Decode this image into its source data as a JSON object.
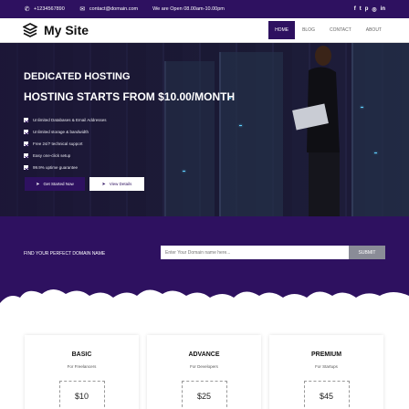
{
  "topbar": {
    "phone": "+1234567890",
    "email": "contact@domain.com",
    "hours": "We are Open 08.00am-10.00pm",
    "social_icons": [
      "facebook-icon",
      "twitter-icon",
      "pinterest-icon",
      "instagram-icon",
      "linkedin-icon"
    ],
    "social_glyphs": [
      "f",
      "t",
      "p",
      "◎",
      "in"
    ]
  },
  "nav": {
    "brand": "My Site",
    "items": [
      {
        "label": "HOME",
        "active": true
      },
      {
        "label": "BLOG",
        "active": false
      },
      {
        "label": "CONTACT",
        "active": false
      },
      {
        "label": "ABOUT",
        "active": false
      }
    ]
  },
  "hero": {
    "title": "DEDICATED HOSTING",
    "subtitle": "HOSTING STARTS FROM $10.00/MONTH",
    "features": [
      "Unlimited Databases & Email Addresses",
      "Unlimited storage & bandwidth",
      "Free 24/7 technical support",
      "Easy one-click setup",
      "99.9% uptime guarantee"
    ],
    "primary_button": "Get Started Now",
    "secondary_button": "View Details"
  },
  "domain": {
    "label": "FIND YOUR PERFECT DOMAIN NAME",
    "input_placeholder": "Enter Your Domain name here...",
    "submit_label": "SUBMIT"
  },
  "pricing": {
    "plans": [
      {
        "name": "BASIC",
        "subtitle": "For Freelancers",
        "price": "$10"
      },
      {
        "name": "ADVANCE",
        "subtitle": "For Developers",
        "price": "$25"
      },
      {
        "name": "PREMIUM",
        "subtitle": "For Startups",
        "price": "$45"
      }
    ]
  },
  "colors": {
    "primary": "#2e1160",
    "submit_button": "#8a8c97"
  }
}
